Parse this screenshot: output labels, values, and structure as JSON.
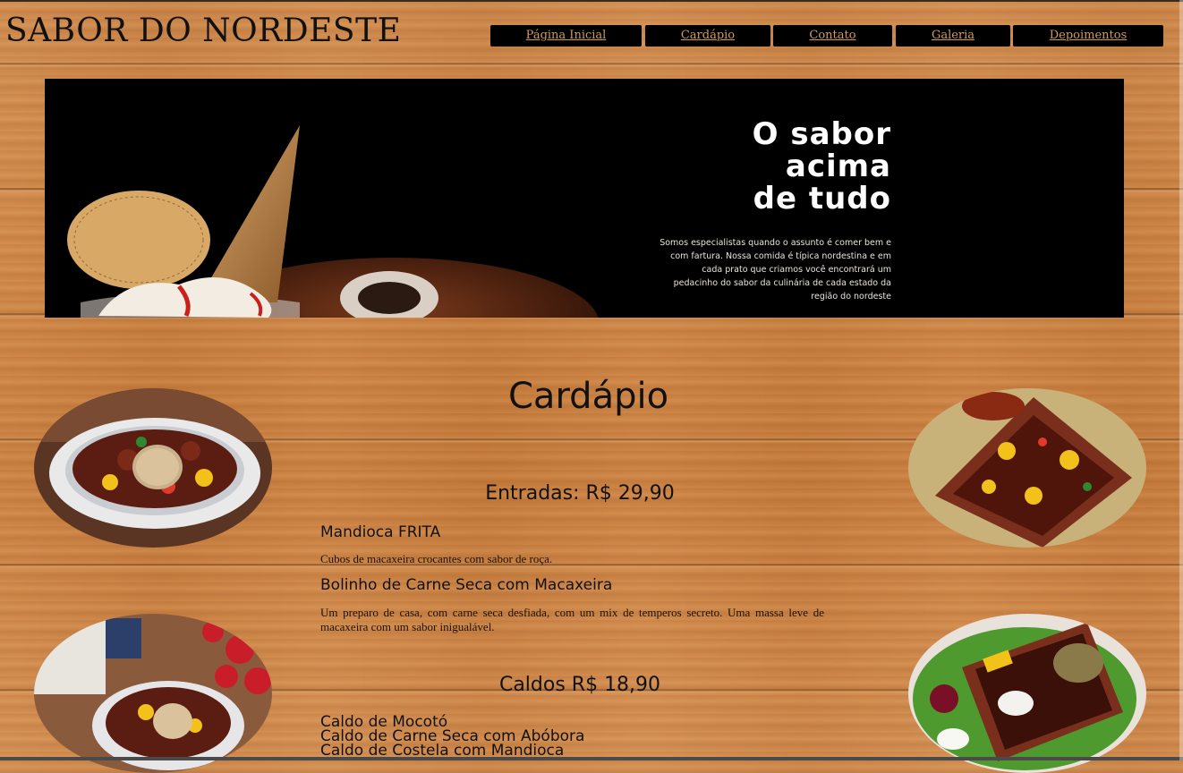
{
  "header": {
    "site_title": "SABOR DO NORDESTE"
  },
  "nav": {
    "items": [
      "Página Inicial",
      "Cardápio",
      "Contato",
      "Galeria",
      "Depoimentos"
    ]
  },
  "hero": {
    "heading": "O sabor\nacima\nde tudo",
    "text": "Somos especialistas quando o assunto é comer bem e com fartura. Nossa comida é típica nordestina e em cada prato que criamos você encontrará um pedacinho do sabor da culinária de cada estado da região do nordeste"
  },
  "menu": {
    "title": "Cardápio",
    "sections": [
      {
        "title": "Entradas: R$ 29,90",
        "items": [
          {
            "name": "Mandioca FRITA",
            "description": "Cubos de macaxeira crocantes com sabor de roça."
          },
          {
            "name": "Bolinho de Carne Seca com Macaxeira",
            "description": "Um preparo de casa, com carne seca desfiada, com um mix de temperos secreto. Uma massa leve de macaxeira com um sabor inigualável."
          }
        ]
      },
      {
        "title": "Caldos R$ 18,90",
        "items": [
          "Caldo de Mocotó",
          "Caldo de Carne Seca com Abóbora",
          "Caldo de Costela com Mandioca"
        ]
      }
    ]
  },
  "colors": {
    "nav_bg": "#000000",
    "nav_text": "#d19a5c",
    "hero_bg": "#000000",
    "wood": "#cf8645"
  }
}
